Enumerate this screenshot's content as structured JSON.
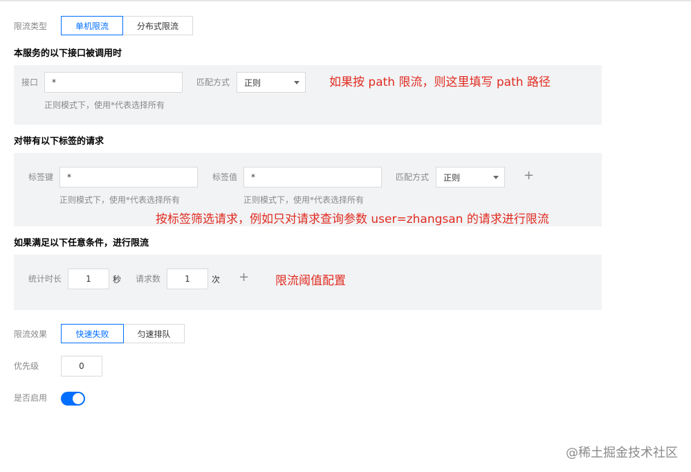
{
  "limit_type": {
    "label": "限流类型",
    "options": [
      "单机限流",
      "分布式限流"
    ],
    "selected": "单机限流"
  },
  "section_api": {
    "title": "本服务的以下接口被调用时",
    "interface_label": "接口",
    "interface_value": "*",
    "match_label": "匹配方式",
    "match_value": "正则",
    "hint": "正则模式下，使用*代表选择所有",
    "annotation": "如果按 path 限流，则这里填写 path 路径"
  },
  "section_tags": {
    "title": "对带有以下标签的请求",
    "key_label": "标签键",
    "key_value": "*",
    "value_label": "标签值",
    "value_value": "*",
    "match_label": "匹配方式",
    "match_value": "正则",
    "key_hint": "正则模式下，使用*代表选择所有",
    "value_hint": "正则模式下，使用*代表选择所有",
    "add_label": "+",
    "annotation": "按标签筛选请求，例如只对请求查询参数 user=zhangsan 的请求进行限流"
  },
  "section_condition": {
    "title": "如果满足以下任意条件，进行限流",
    "duration_label": "统计时长",
    "duration_value": "1",
    "duration_unit": "秒",
    "count_label": "请求数",
    "count_value": "1",
    "count_unit": "次",
    "add_label": "+",
    "annotation": "限流阈值配置"
  },
  "limit_effect": {
    "label": "限流效果",
    "options": [
      "快速失败",
      "匀速排队"
    ],
    "selected": "快速失败"
  },
  "priority": {
    "label": "优先级",
    "value": "0"
  },
  "enabled": {
    "label": "是否启用",
    "on": true
  },
  "watermark": "@稀土掘金技术社区",
  "colors": {
    "accent": "#006eff",
    "annotation": "#e02b20",
    "panel": "#f2f3f5"
  }
}
